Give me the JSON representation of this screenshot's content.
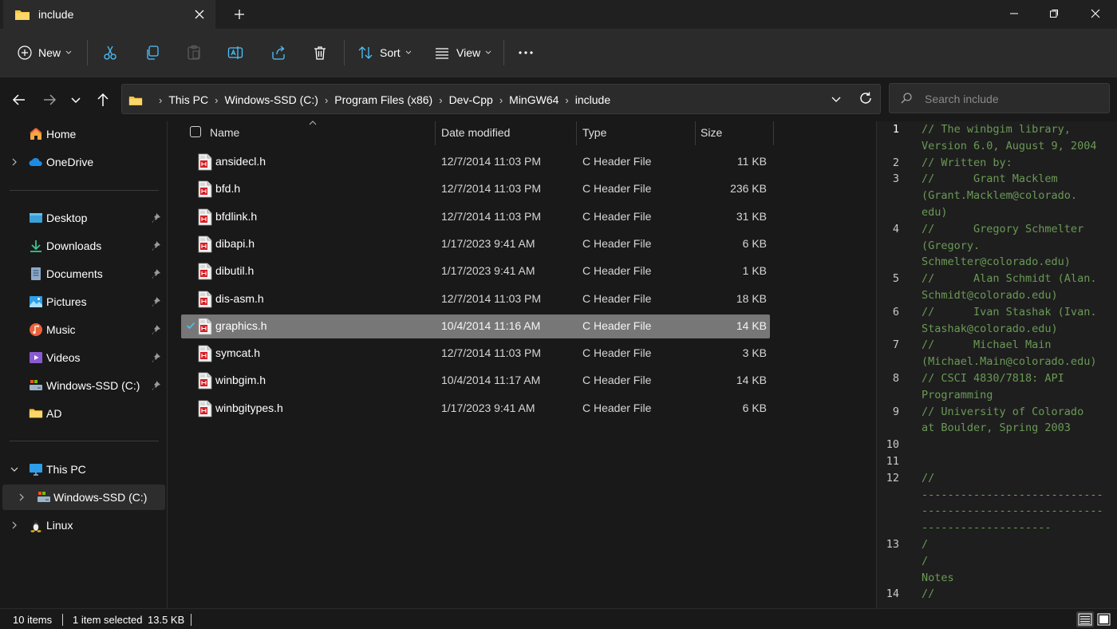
{
  "window": {
    "tab_title": "include",
    "tab_icon": "folder-icon",
    "controls": [
      "minimize-icon",
      "maximize-icon",
      "close-icon"
    ]
  },
  "toolbar": {
    "new_label": "New",
    "sort_label": "Sort",
    "view_label": "View",
    "icons": [
      "cut-icon",
      "copy-icon",
      "paste-icon",
      "rename-icon",
      "share-icon",
      "delete-icon",
      "more-icon"
    ]
  },
  "address": {
    "crumbs": [
      "This PC",
      "Windows-SSD (C:)",
      "Program Files (x86)",
      "Dev-Cpp",
      "MinGW64",
      "include"
    ],
    "search_placeholder": "Search include"
  },
  "sidebar": {
    "items": [
      {
        "label": "Home",
        "icon": "home-icon"
      },
      {
        "label": "OneDrive",
        "icon": "cloud-icon"
      },
      {
        "label": "Desktop",
        "icon": "desktop-icon"
      },
      {
        "label": "Downloads",
        "icon": "download-icon"
      },
      {
        "label": "Documents",
        "icon": "documents-icon"
      },
      {
        "label": "Pictures",
        "icon": "pictures-icon"
      },
      {
        "label": "Music",
        "icon": "music-icon"
      },
      {
        "label": "Videos",
        "icon": "videos-icon"
      },
      {
        "label": "Windows-SSD (C:)",
        "icon": "drive-icon"
      },
      {
        "label": "AD",
        "icon": "folder-icon"
      },
      {
        "label": "This PC",
        "icon": "computer-icon"
      },
      {
        "label": "Windows-SSD (C:)",
        "icon": "drive-icon"
      },
      {
        "label": "Linux",
        "icon": "linux-icon"
      }
    ]
  },
  "list": {
    "columns": {
      "name": "Name",
      "date": "Date modified",
      "type": "Type",
      "size": "Size"
    },
    "files": [
      {
        "name": "ansidecl.h",
        "date": "12/7/2014 11:03 PM",
        "type": "C Header File",
        "size": "11 KB"
      },
      {
        "name": "bfd.h",
        "date": "12/7/2014 11:03 PM",
        "type": "C Header File",
        "size": "236 KB"
      },
      {
        "name": "bfdlink.h",
        "date": "12/7/2014 11:03 PM",
        "type": "C Header File",
        "size": "31 KB"
      },
      {
        "name": "dibapi.h",
        "date": "1/17/2023 9:41 AM",
        "type": "C Header File",
        "size": "6 KB"
      },
      {
        "name": "dibutil.h",
        "date": "1/17/2023 9:41 AM",
        "type": "C Header File",
        "size": "1 KB"
      },
      {
        "name": "dis-asm.h",
        "date": "12/7/2014 11:03 PM",
        "type": "C Header File",
        "size": "18 KB"
      },
      {
        "name": "graphics.h",
        "date": "10/4/2014 11:16 AM",
        "type": "C Header File",
        "size": "14 KB"
      },
      {
        "name": "symcat.h",
        "date": "12/7/2014 11:03 PM",
        "type": "C Header File",
        "size": "3 KB"
      },
      {
        "name": "winbgim.h",
        "date": "10/4/2014 11:17 AM",
        "type": "C Header File",
        "size": "14 KB"
      },
      {
        "name": "winbgitypes.h",
        "date": "1/17/2023 9:41 AM",
        "type": "C Header File",
        "size": "6 KB"
      }
    ]
  },
  "preview": {
    "lines": [
      {
        "n": "1",
        "text": [
          "// The winbgim library,",
          "Version 6.0, August 9, 2004"
        ]
      },
      {
        "n": "2",
        "text": [
          "// Written by:"
        ]
      },
      {
        "n": "3",
        "text": [
          "//      Grant Macklem",
          "(Grant.Macklem@colorado.",
          "edu)"
        ]
      },
      {
        "n": "4",
        "text": [
          "//      Gregory Schmelter",
          "(Gregory.",
          "Schmelter@colorado.edu)"
        ]
      },
      {
        "n": "5",
        "text": [
          "//      Alan Schmidt (Alan.",
          "Schmidt@colorado.edu)"
        ]
      },
      {
        "n": "6",
        "text": [
          "//      Ivan Stashak (Ivan.",
          "Stashak@colorado.edu)"
        ]
      },
      {
        "n": "7",
        "text": [
          "//      Michael Main",
          "(Michael.Main@colorado.edu)"
        ]
      },
      {
        "n": "8",
        "text": [
          "// CSCI 4830/7818: API",
          "Programming"
        ]
      },
      {
        "n": "9",
        "text": [
          "// University of Colorado",
          "at Boulder, Spring 2003"
        ]
      },
      {
        "n": "10",
        "text": [
          ""
        ]
      },
      {
        "n": "11",
        "text": [
          ""
        ]
      },
      {
        "n": "12",
        "text": [
          "//",
          "----------------------------",
          "----------------------------",
          "--------------------"
        ]
      },
      {
        "n": "13",
        "text": [
          "/",
          "/",
          "Notes"
        ]
      },
      {
        "n": "14",
        "text": [
          "//"
        ]
      }
    ]
  },
  "status": {
    "count": "10 items",
    "selected": "1 item selected",
    "size": "13.5 KB"
  },
  "colors": {
    "accent": "#4cc2ff",
    "code_comment": "#6a9955",
    "selection": "#777777",
    "folder": "#f8c441"
  }
}
